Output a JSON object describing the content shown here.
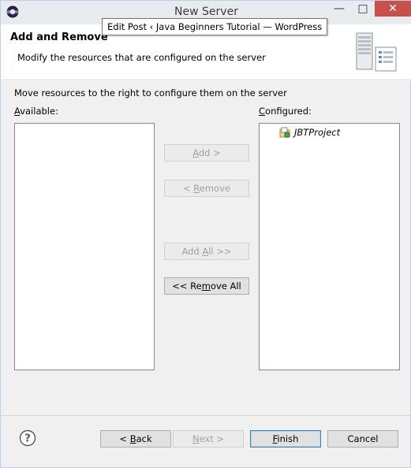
{
  "window": {
    "title": "New Server",
    "minimize_glyph": "—",
    "maximize_glyph": "□",
    "close_glyph": "✕"
  },
  "tooltip": {
    "text": "Edit Post ‹ Java Beginners Tutorial — WordPress"
  },
  "header": {
    "title": "Add and Remove",
    "description": "Modify the resources that are configured on the server"
  },
  "instruction": "Move resources to the right to configure them on the server",
  "available": {
    "label_mnemonic": "A",
    "label_rest": "vailable:",
    "items": []
  },
  "configured": {
    "label_mnemonic": "C",
    "label_rest": "onfigured:",
    "items": [
      {
        "label": "JBTProject",
        "icon": "project-icon"
      }
    ]
  },
  "transfer_buttons": {
    "add": {
      "mnemonic": "A",
      "pre": "",
      "post": "dd >",
      "enabled": false
    },
    "remove": {
      "mnemonic": "R",
      "pre": "< ",
      "post": "emove",
      "enabled": false
    },
    "add_all": {
      "mnemonic": "A",
      "pre": "Add ",
      "post": "ll >>",
      "enabled": false
    },
    "remove_all": {
      "mnemonic": "m",
      "pre": "<< Re",
      "post": "ove All",
      "enabled": true
    }
  },
  "footer": {
    "back": {
      "mnemonic": "B",
      "pre": "< ",
      "post": "ack",
      "enabled": true
    },
    "next": {
      "mnemonic": "N",
      "pre": "",
      "post": "ext >",
      "enabled": false
    },
    "finish": {
      "mnemonic": "F",
      "pre": "",
      "post": "inish",
      "enabled": true
    },
    "cancel": {
      "label": "Cancel",
      "enabled": true
    }
  },
  "colors": {
    "close_button": "#c7504b",
    "default_border": "#3c7fb1",
    "window_bg": "#f0f0f0"
  }
}
